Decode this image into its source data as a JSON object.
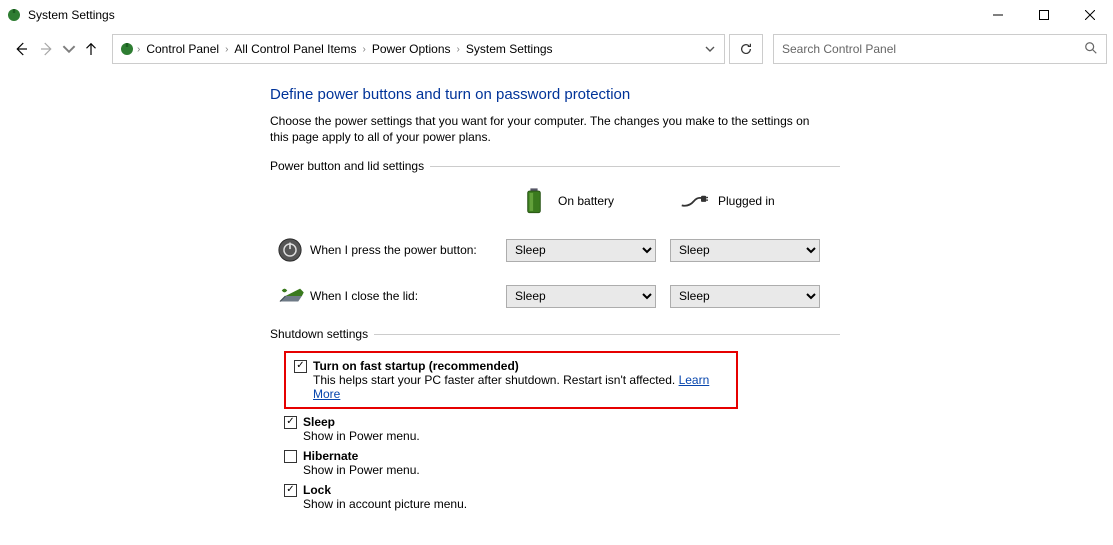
{
  "window": {
    "title": "System Settings"
  },
  "breadcrumb": {
    "items": [
      "Control Panel",
      "All Control Panel Items",
      "Power Options",
      "System Settings"
    ]
  },
  "search": {
    "placeholder": "Search Control Panel"
  },
  "page": {
    "heading": "Define power buttons and turn on password protection",
    "description": "Choose the power settings that you want for your computer. The changes you make to the settings on this page apply to all of your power plans."
  },
  "section1": {
    "label": "Power button and lid settings",
    "col_battery": "On battery",
    "col_plugged": "Plugged in",
    "row1_label": "When I press the power button:",
    "row1_battery": "Sleep",
    "row1_plugged": "Sleep",
    "row2_label": "When I close the lid:",
    "row2_battery": "Sleep",
    "row2_plugged": "Sleep"
  },
  "section2": {
    "label": "Shutdown settings",
    "items": [
      {
        "checked": true,
        "label": "Turn on fast startup (recommended)",
        "sub_prefix": "This helps start your PC faster after shutdown. Restart isn't affected. ",
        "link": "Learn More",
        "highlighted": true
      },
      {
        "checked": true,
        "label": "Sleep",
        "sub": "Show in Power menu."
      },
      {
        "checked": false,
        "label": "Hibernate",
        "sub": "Show in Power menu."
      },
      {
        "checked": true,
        "label": "Lock",
        "sub": "Show in account picture menu."
      }
    ]
  }
}
